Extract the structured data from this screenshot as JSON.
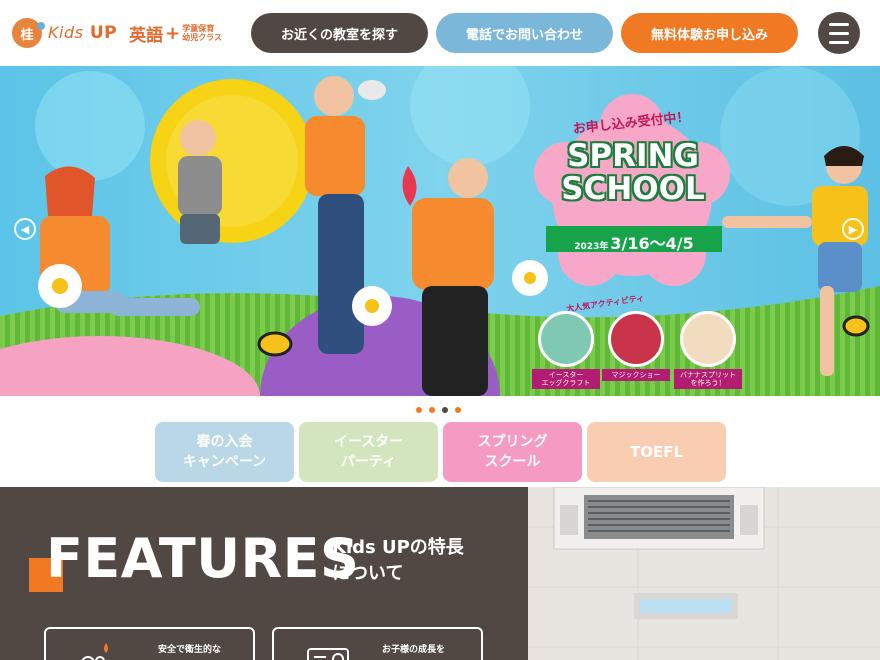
{
  "header": {
    "logo_mark": "桂",
    "logo_kids": "Kids",
    "logo_up": "UP",
    "logo_english": "英語",
    "logo_plus": "+",
    "logo_sub_top": "学童保育",
    "logo_sub_bottom": "幼児クラス",
    "btn_classroom": "お近くの教室を探す",
    "btn_phone": "電話でお問い合わせ",
    "btn_trial": "無料体験お申し込み",
    "menu_icon": "hamburger-menu-icon"
  },
  "hero": {
    "tag": "お申し込み受付中！",
    "title_line1": "SPRING",
    "title_line2": "SCHOOL",
    "date_year": "2023年",
    "date_range": "3/16〜4/5",
    "activities_heading": "大人気アクティビティ",
    "activities": [
      {
        "label": "イースター\nエッグクラフト",
        "color": "#7fc9b2"
      },
      {
        "label": "マジックショー",
        "color": "#c9344b"
      },
      {
        "label": "バナナスプリット\nを作ろう！",
        "color": "#f2dcc0"
      }
    ],
    "prev_arrow": "arrow-left-icon",
    "next_arrow": "arrow-right-icon",
    "slide_count": 4,
    "active_slide": 3
  },
  "tabs": [
    {
      "label": "春の入会\nキャンペーン",
      "color": "#b9d7e7"
    },
    {
      "label": "イースター\nパーティ",
      "color": "#d3e5bd"
    },
    {
      "label": "スプリング\nスクール",
      "color": "#f59ac2"
    },
    {
      "label": "TOEFL",
      "color": "#f9cdb1"
    }
  ],
  "features": {
    "title": "FEATURES",
    "subtitle": "Kids UPの特長\nについて",
    "card1_text": "安全で衛生的な",
    "card2_text": "お子様の成長を"
  },
  "colors": {
    "brand_orange": "#f07a24",
    "brand_brown": "#514843",
    "brand_blue": "#7bb7d9"
  }
}
